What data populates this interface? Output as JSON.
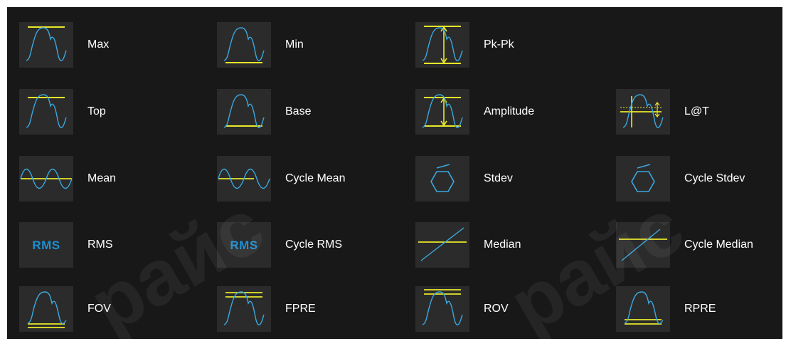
{
  "colors": {
    "background": "#181818",
    "tile": "#2b2b2b",
    "waveform": "#3aa8e0",
    "marker": "#e8e82a",
    "text": "#ffffff"
  },
  "watermark": "paйc",
  "items": [
    {
      "label": "Max",
      "icon": "max-icon"
    },
    {
      "label": "Min",
      "icon": "min-icon"
    },
    {
      "label": "Pk-Pk",
      "icon": "pk-pk-icon"
    },
    {
      "label": "Top",
      "icon": "top-icon"
    },
    {
      "label": "Base",
      "icon": "base-icon"
    },
    {
      "label": "Amplitude",
      "icon": "amplitude-icon"
    },
    {
      "label": "L@T",
      "icon": "l-at-t-icon"
    },
    {
      "label": "Mean",
      "icon": "mean-icon"
    },
    {
      "label": "Cycle Mean",
      "icon": "cycle-mean-icon"
    },
    {
      "label": "Stdev",
      "icon": "stdev-icon"
    },
    {
      "label": "Cycle Stdev",
      "icon": "cycle-stdev-icon"
    },
    {
      "label": "RMS",
      "icon": "rms-icon",
      "icon_text": "RMS"
    },
    {
      "label": "Cycle RMS",
      "icon": "cycle-rms-icon",
      "icon_text": "RMS"
    },
    {
      "label": "Median",
      "icon": "median-icon"
    },
    {
      "label": "Cycle Median",
      "icon": "cycle-median-icon"
    },
    {
      "label": "FOV",
      "icon": "fov-icon"
    },
    {
      "label": "FPRE",
      "icon": "fpre-icon"
    },
    {
      "label": "ROV",
      "icon": "rov-icon"
    },
    {
      "label": "RPRE",
      "icon": "rpre-icon"
    }
  ]
}
